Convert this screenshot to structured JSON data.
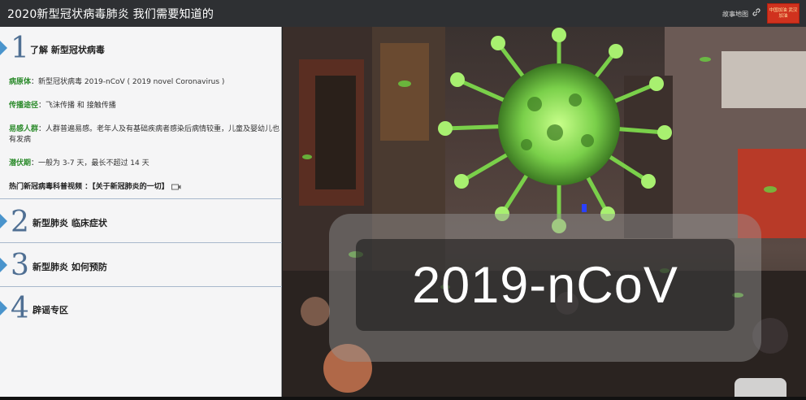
{
  "header": {
    "title": "2020新型冠状病毒肺炎  我们需要知道的",
    "story_map_label": "故事地图",
    "logo_text": "中国加油 武汉加油"
  },
  "sidebar": {
    "sections": [
      {
        "number": "1",
        "title": "了解 新型冠状病毒"
      },
      {
        "number": "2",
        "title": "新型肺炎 临床症状"
      },
      {
        "number": "3",
        "title": "新型肺炎 如何预防"
      },
      {
        "number": "4",
        "title": "辟谣专区"
      }
    ],
    "content": {
      "pathogen_label": "病原体",
      "pathogen_text": "：新型冠状病毒 2019-nCoV ( 2019 novel Coronavirus )",
      "transmission_label": "传播途径",
      "transmission_text": "：飞沫传播 和 接触传播",
      "susceptible_label": "易感人群",
      "susceptible_text": "：人群普遍易感。老年人及有基础疾病者感染后病情较重，儿童及婴幼儿也有发病",
      "incubation_label": "潜伏期",
      "incubation_text": "：一般为 3-7 天，最长不超过 14 天",
      "video_text": "热门新冠病毒科普视频 ：【关于新冠肺炎的一切】"
    }
  },
  "media": {
    "overlay_text": "2019-nCoV"
  },
  "colors": {
    "topbar": "#2e3033",
    "accent_blue": "#4a94cc",
    "section_number": "#4f6f93",
    "label_green": "#2a8a2a",
    "virus_green": "#8fe05a"
  }
}
